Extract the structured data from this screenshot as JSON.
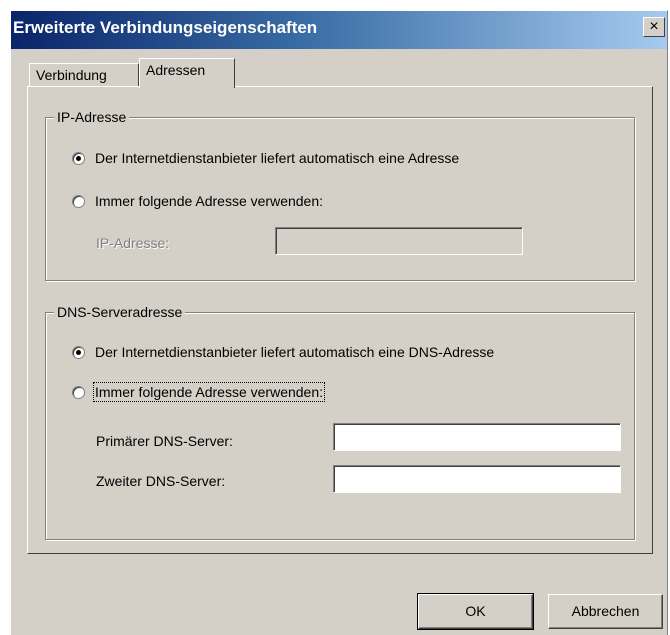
{
  "window": {
    "title": "Erweiterte Verbindungseigenschaften",
    "close_glyph": "×"
  },
  "tabs": [
    {
      "label": "Verbindung",
      "active": false
    },
    {
      "label": "Adressen",
      "active": true
    }
  ],
  "ip_group": {
    "title": "IP-Adresse",
    "radio_auto": {
      "label": "Der Internetdienstanbieter liefert automatisch eine Adresse",
      "checked": true
    },
    "radio_manual": {
      "label": "Immer folgende Adresse verwenden:",
      "checked": false
    },
    "ip_field": {
      "label": "IP-Adresse:",
      "value": "",
      "disabled": true
    }
  },
  "dns_group": {
    "title": "DNS-Serveradresse",
    "radio_auto": {
      "label": "Der Internetdienstanbieter liefert automatisch eine DNS-Adresse",
      "checked": true
    },
    "radio_manual": {
      "label": "Immer folgende Adresse verwenden:",
      "checked": false
    },
    "primary_field": {
      "label": "Primärer DNS-Server:",
      "value": ""
    },
    "secondary_field": {
      "label": "Zweiter DNS-Server:",
      "value": ""
    }
  },
  "buttons": {
    "ok": "OK",
    "cancel": "Abbrechen"
  }
}
